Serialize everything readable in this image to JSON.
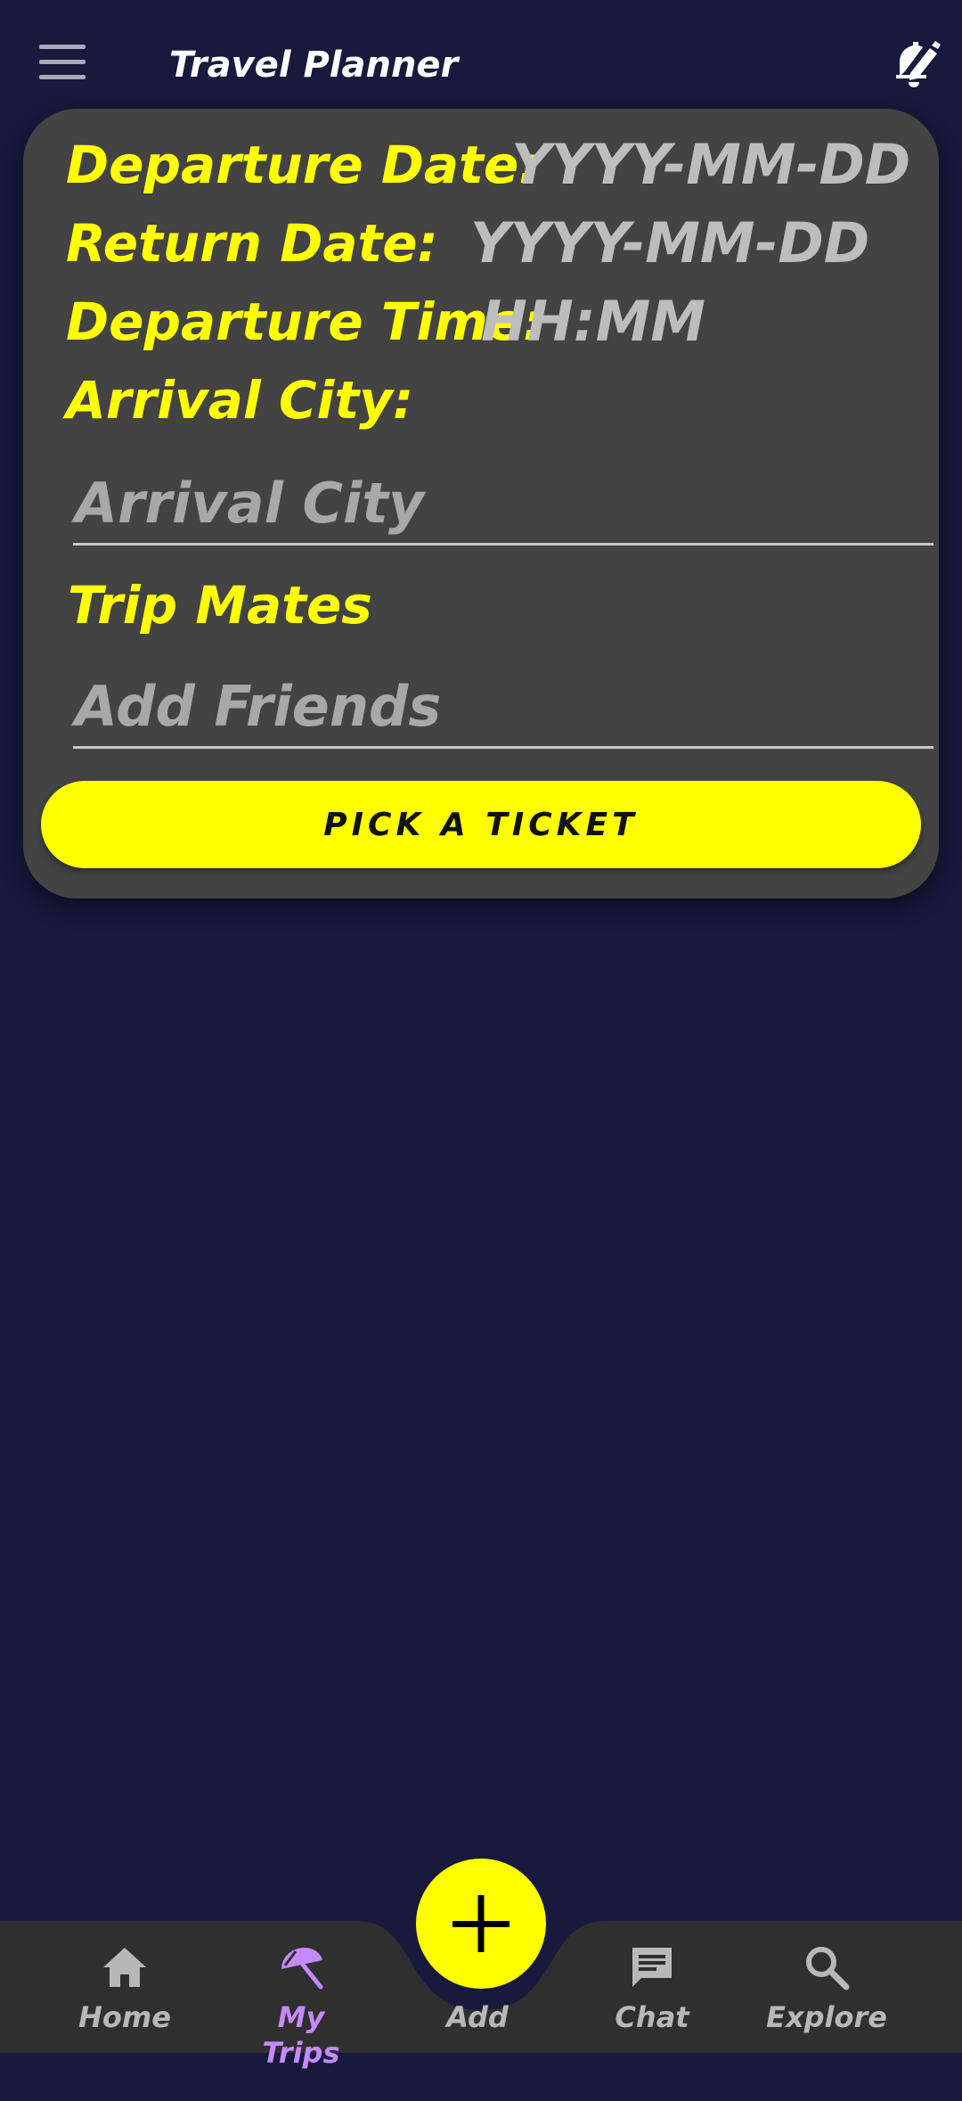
{
  "app_bar": {
    "title": "Travel Planner",
    "menu_icon": "hamburger-menu-icon",
    "action_icon": "bell-edit-icon"
  },
  "form": {
    "departure_date": {
      "label": "Departure Date:",
      "value": "YYYY-MM-DD"
    },
    "return_date": {
      "label": "Return Date:",
      "value": "YYYY-MM-DD"
    },
    "departure_time": {
      "label": "Departure Time:",
      "value": "HH:MM"
    },
    "arrival_city": {
      "label": "Arrival City:",
      "placeholder": "Arrival City"
    },
    "trip_mates": {
      "label": "Trip Mates",
      "placeholder": "Add Friends"
    },
    "submit_label": "PICK A TICKET"
  },
  "bottom_nav": {
    "items": [
      {
        "label": "Home",
        "icon": "home-icon",
        "active": false
      },
      {
        "label": "My Trips",
        "icon": "beach-umbrella-icon",
        "active": true
      },
      {
        "label": "Add",
        "icon": "plus-icon",
        "active": false
      },
      {
        "label": "Chat",
        "icon": "chat-icon",
        "active": false
      },
      {
        "label": "Explore",
        "icon": "search-icon",
        "active": false
      }
    ]
  },
  "colors": {
    "background": "#17193d",
    "card": "#434343",
    "accent": "#ffff00",
    "active_nav": "#c58af9",
    "nav_bar": "#2f2f2f"
  }
}
